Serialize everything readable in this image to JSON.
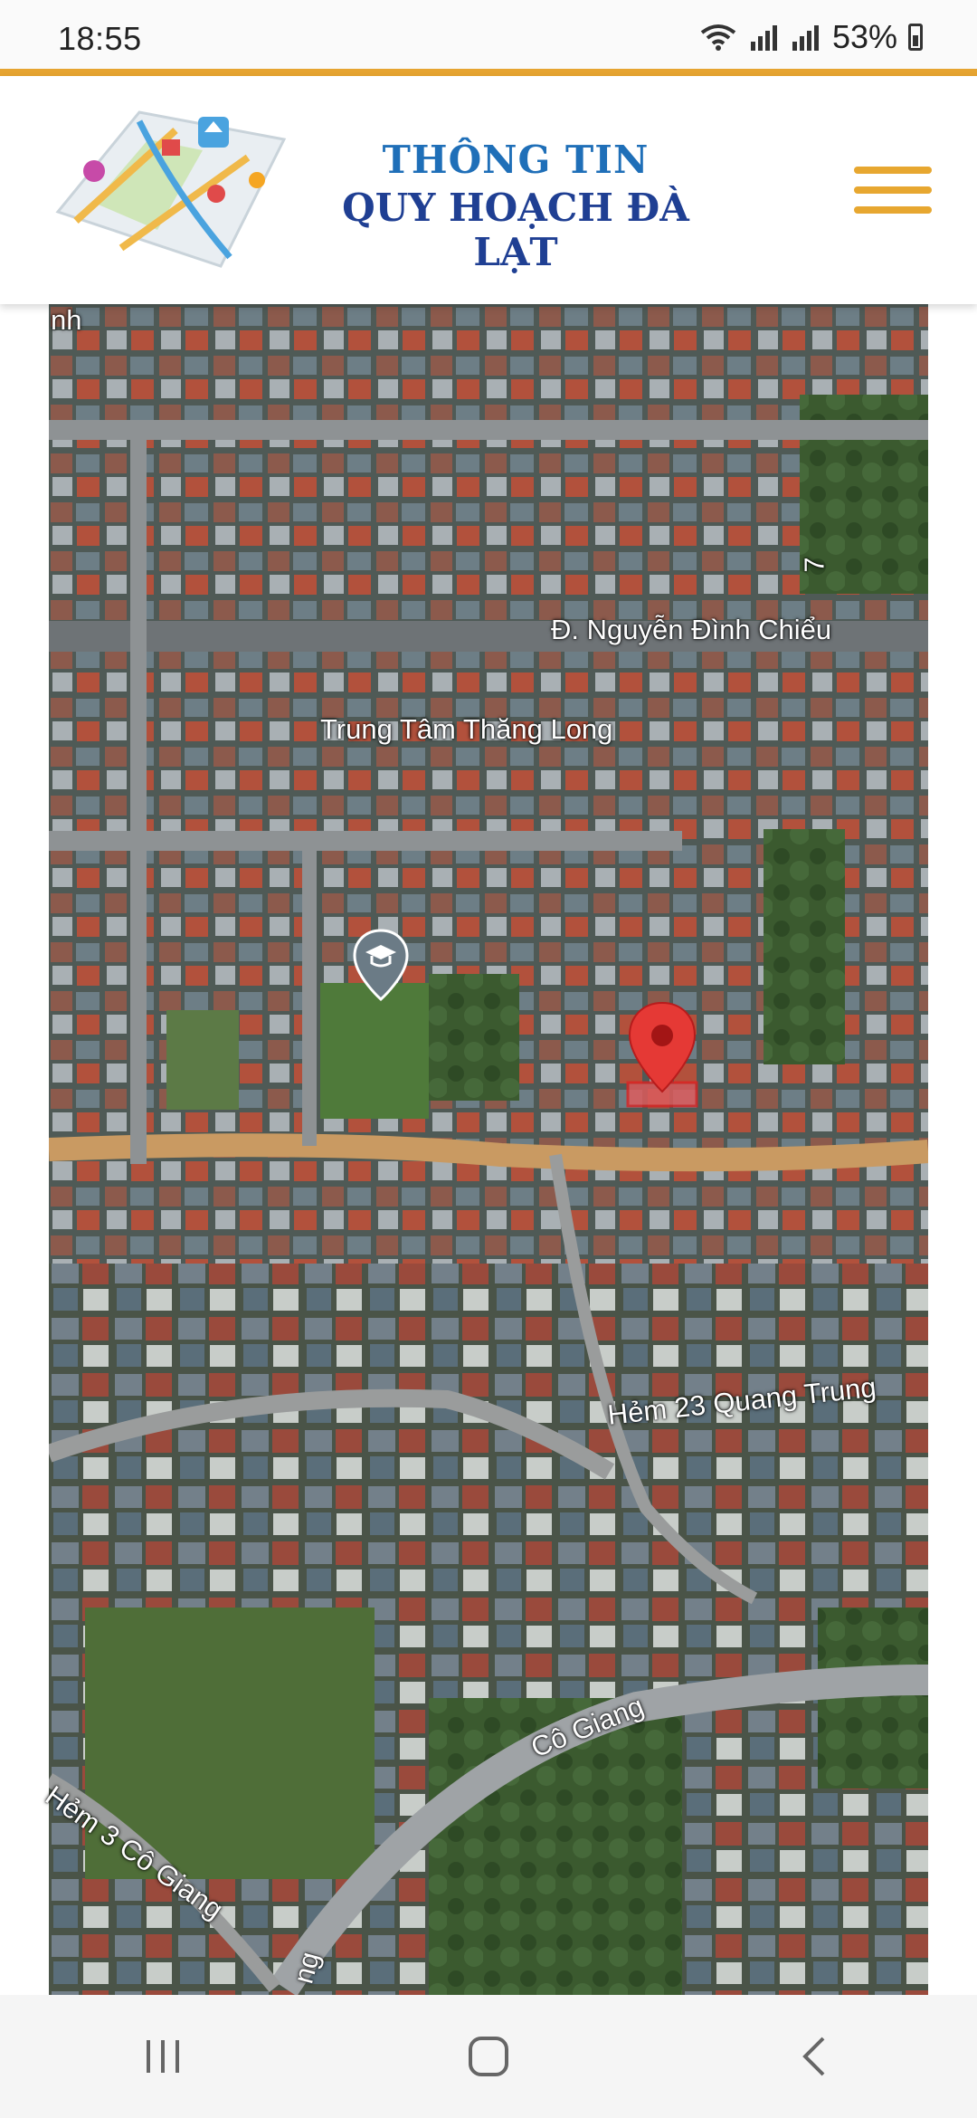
{
  "status_bar": {
    "time": "18:55",
    "battery": "53%"
  },
  "header": {
    "brand_line1": "THÔNG TIN",
    "brand_line2": "QUY HOẠCH ĐÀ LẠT",
    "colors": {
      "accent": "#e6a431",
      "brand_blue": "#1f6fb8",
      "brand_dark_blue": "#1f3f93"
    }
  },
  "map": {
    "type": "satellite",
    "labels": {
      "edge_top": "nh",
      "street_nguyen_dinh_chieu": "Đ. Nguyễn Đình Chiểu",
      "poi_trung_tam": "Trung Tâm Thăng Long",
      "street_hem_23": "Hẻm 23 Quang Trung",
      "street_co_giang": "Cô Giang",
      "street_hem_3": "Hẻm 3 Cô Giang",
      "edge_right_digit": "7",
      "edge_bottom": "ng"
    },
    "marker": {
      "icon": "map-pin-icon",
      "color": "#e53935"
    },
    "poi_icon": "graduation-cap-icon"
  },
  "nav": {
    "recents_icon": "recents-icon",
    "home_icon": "home-icon",
    "back_icon": "back-icon"
  }
}
